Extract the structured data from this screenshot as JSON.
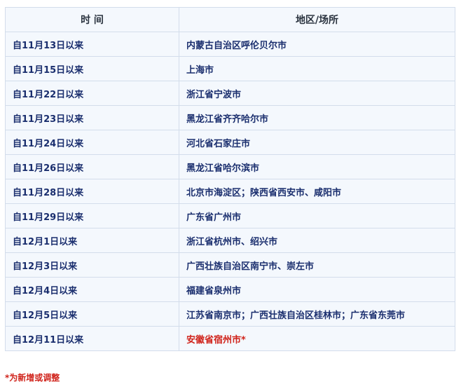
{
  "table": {
    "headers": [
      "时 间",
      "地区/场所"
    ],
    "rows": [
      {
        "time": "自11月13日以来",
        "location": "内蒙古自治区呼伦贝尔市"
      },
      {
        "time": "自11月15日以来",
        "location": "上海市"
      },
      {
        "time": "自11月22日以来",
        "location": "浙江省宁波市"
      },
      {
        "time": "自11月23日以来",
        "location": "黑龙江省齐齐哈尔市"
      },
      {
        "time": "自11月24日以来",
        "location": "河北省石家庄市"
      },
      {
        "time": "自11月26日以来",
        "location": "黑龙江省哈尔滨市"
      },
      {
        "time": "自11月28日以来",
        "location": "北京市海淀区；陕西省西安市、咸阳市"
      },
      {
        "time": "自11月29日以来",
        "location": "广东省广州市"
      },
      {
        "time": "自12月1日以来",
        "location": "浙江省杭州市、绍兴市"
      },
      {
        "time": "自12月3日以来",
        "location": "广西壮族自治区南宁市、崇左市"
      },
      {
        "time": "自12月4日以来",
        "location": "福建省泉州市"
      },
      {
        "time": "自12月5日以来",
        "location": "江苏省南京市；广西壮族自治区桂林市；广东省东莞市"
      },
      {
        "time": "自12月11日以来",
        "location": "安徽省宿州市*"
      }
    ]
  },
  "footnote": "*为新增或调整",
  "colors": {
    "text": "#1a2e6e",
    "highlight": "#d0231b",
    "border": "#d3ddeb",
    "background": "#f4f8fd"
  }
}
